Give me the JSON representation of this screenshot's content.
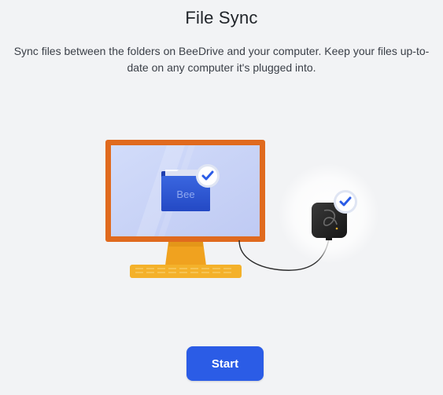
{
  "header": {
    "title": "File Sync",
    "description": "Sync files between the folders on BeeDrive and your computer. Keep your files up-to-date on any computer it's plugged into."
  },
  "illustration": {
    "folder_label": "Bee",
    "monitor_icon": "check-badge-icon",
    "device_icon": "check-badge-icon"
  },
  "actions": {
    "start_label": "Start"
  },
  "colors": {
    "accent": "#2b5ce6",
    "monitor_frame": "#e06a1e",
    "monitor_screen": "#c6d1f6",
    "stand": "#f4b12a",
    "folder": "#2f5ad6"
  }
}
